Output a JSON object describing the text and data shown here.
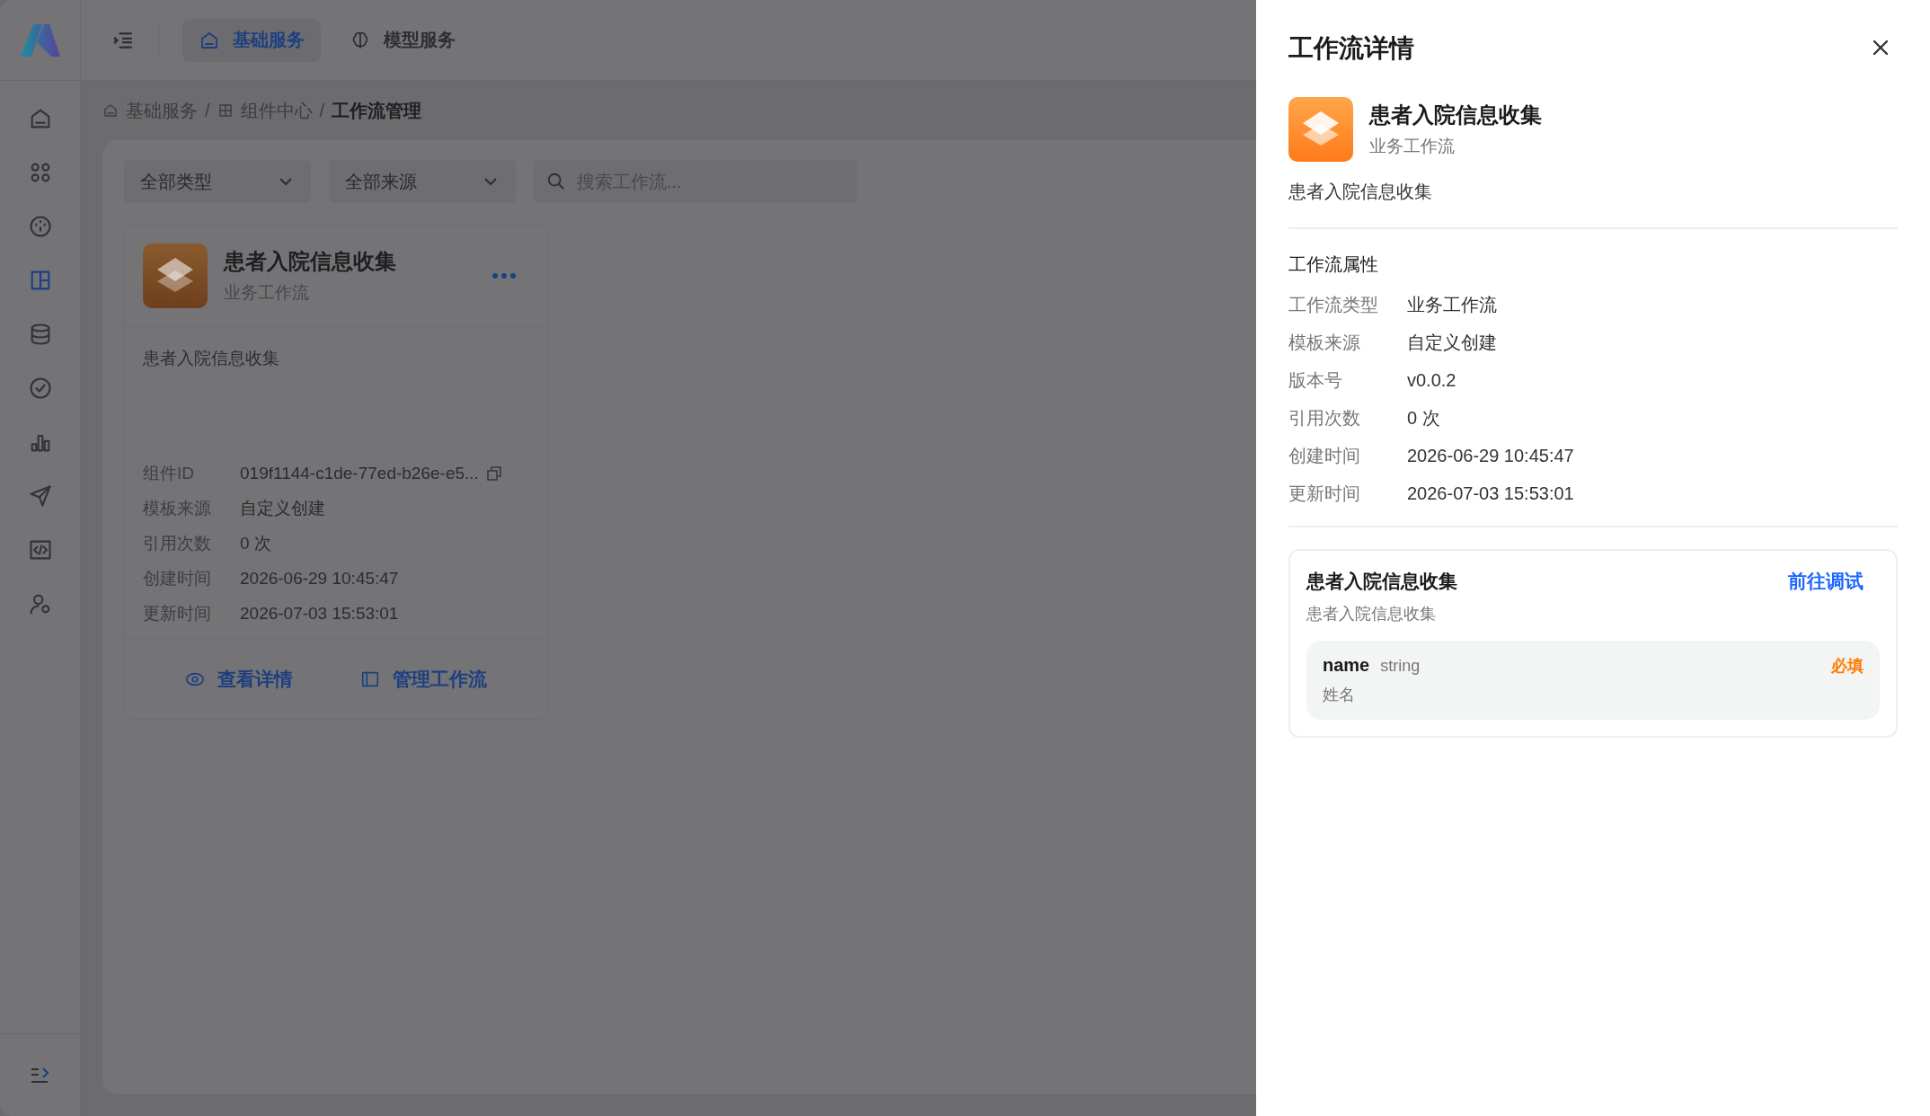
{
  "header": {
    "tabs": [
      {
        "label": "基础服务",
        "selected": true
      },
      {
        "label": "模型服务",
        "selected": false
      }
    ]
  },
  "sidebar": {
    "items": [
      {
        "kind": "home",
        "selected": false
      },
      {
        "kind": "apps",
        "selected": false
      },
      {
        "kind": "gauge",
        "selected": false
      },
      {
        "kind": "layout",
        "selected": true
      },
      {
        "kind": "database",
        "selected": false
      },
      {
        "kind": "check",
        "selected": false
      },
      {
        "kind": "chart",
        "selected": false
      },
      {
        "kind": "send",
        "selected": false
      },
      {
        "kind": "code",
        "selected": false
      },
      {
        "kind": "user",
        "selected": false
      }
    ]
  },
  "breadcrumb": [
    {
      "kind": "link",
      "label": "基础服务",
      "selected": false
    },
    {
      "kind": "separator",
      "label": "/"
    },
    {
      "kind": "link",
      "label": "组件中心",
      "selected": false
    },
    {
      "kind": "separator",
      "label": "/"
    },
    {
      "kind": "link",
      "label": "工作流管理",
      "selected": true
    }
  ],
  "filters": {
    "type_select": "全部类型",
    "source_select": "全部来源",
    "search": {
      "placeholder": "搜索工作流..."
    }
  },
  "workflow_cards": [
    {
      "title": "患者入院信息收集",
      "subtitle": "业务工作流",
      "description": "患者入院信息收集",
      "fields": [
        {
          "label": "组件ID",
          "value": "019f1144-c1de-77ed-b26e-e5...",
          "copyable": true
        },
        {
          "label": "模板来源",
          "value": "自定义创建",
          "copyable": false
        },
        {
          "label": "引用次数",
          "value": "0 次",
          "copyable": false
        },
        {
          "label": "创建时间",
          "value": "2026-06-29 10:45:47",
          "copyable": false
        },
        {
          "label": "更新时间",
          "value": "2026-07-03 15:53:01",
          "copyable": false
        }
      ],
      "actions": [
        {
          "label": "查看详情"
        },
        {
          "label": "管理工作流"
        }
      ]
    }
  ],
  "drawer": {
    "title": "工作流详情",
    "name": "患者入院信息收集",
    "type": "业务工作流",
    "description": "患者入院信息收集",
    "section_title": "工作流属性",
    "properties": [
      {
        "label": "工作流类型",
        "value": "业务工作流"
      },
      {
        "label": "模板来源",
        "value": "自定义创建"
      },
      {
        "label": "版本号",
        "value": "v0.0.2"
      },
      {
        "label": "引用次数",
        "value": "0 次"
      },
      {
        "label": "创建时间",
        "value": "2026-06-29 10:45:47"
      },
      {
        "label": "更新时间",
        "value": "2026-07-03 15:53:01"
      }
    ],
    "interface": {
      "title": "患者入院信息收集",
      "description": "患者入院信息收集",
      "action": "前往调试",
      "params": [
        {
          "name": "name",
          "type": "string",
          "description": "姓名",
          "required": true,
          "required_label": "必填"
        }
      ]
    }
  }
}
